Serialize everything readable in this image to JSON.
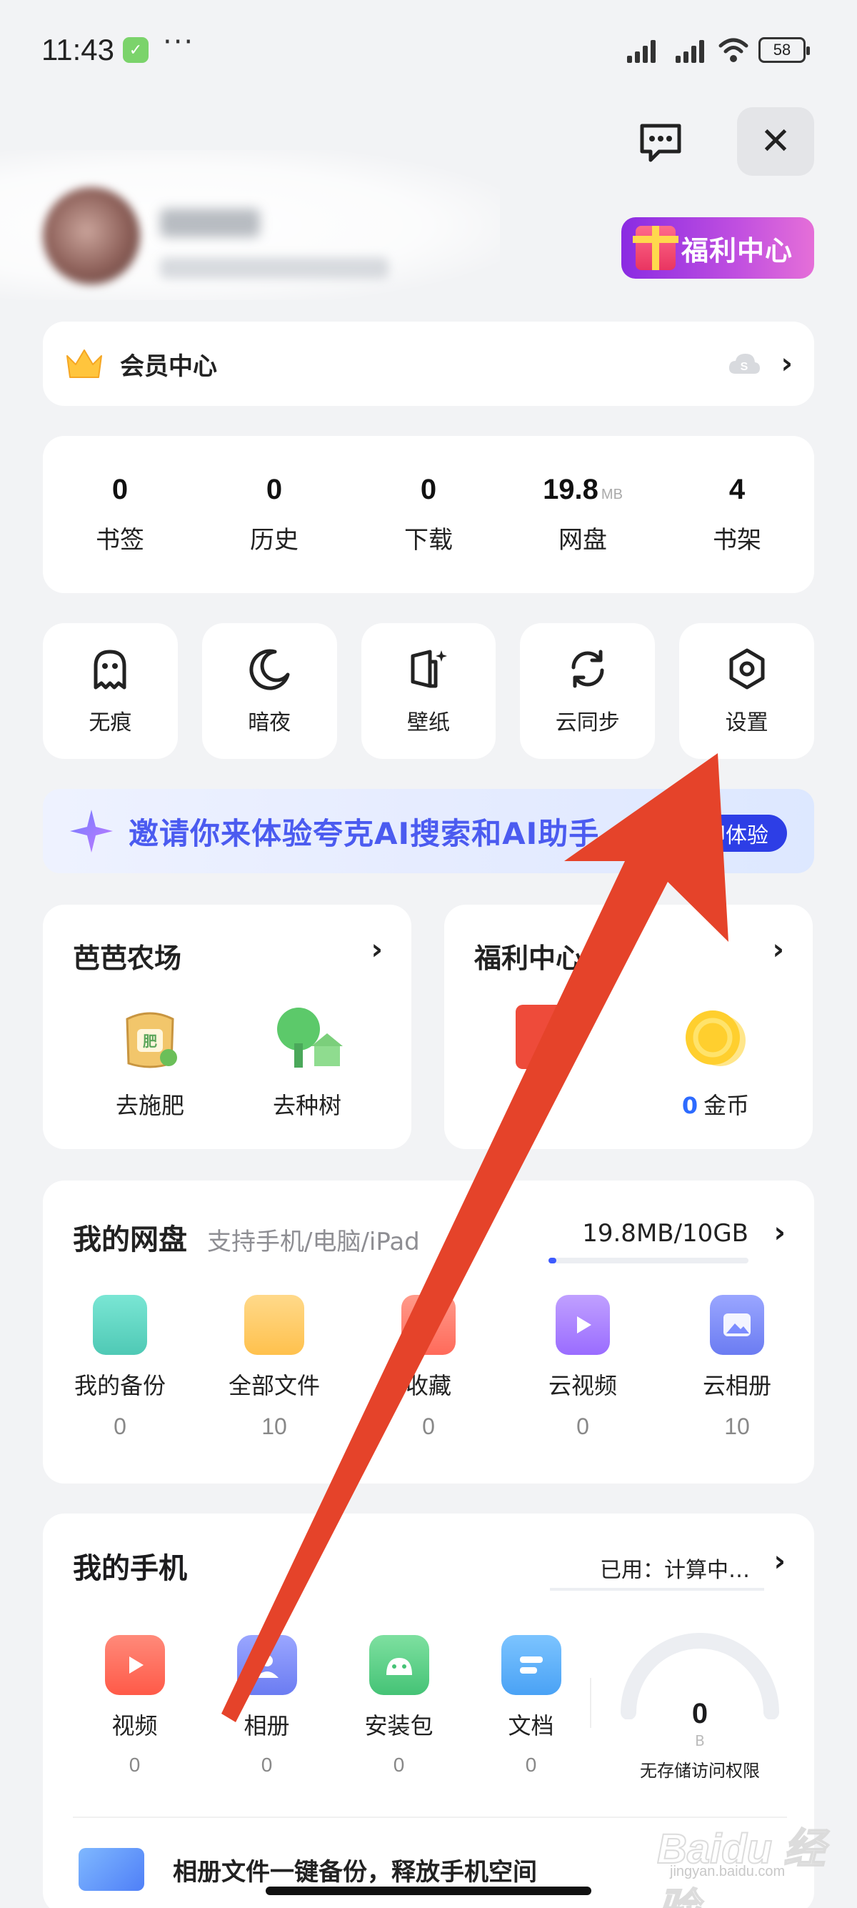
{
  "status_bar": {
    "time": "11:43",
    "battery": "58",
    "dots": "···"
  },
  "header": {
    "close_glyph": "✕",
    "welfare_label": "福利中心"
  },
  "member": {
    "label": "会员中心"
  },
  "stats": [
    {
      "value": "0",
      "unit": "",
      "label": "书签"
    },
    {
      "value": "0",
      "unit": "",
      "label": "历史"
    },
    {
      "value": "0",
      "unit": "",
      "label": "下载"
    },
    {
      "value": "19.8",
      "unit": "MB",
      "label": "网盘"
    },
    {
      "value": "4",
      "unit": "",
      "label": "书架"
    }
  ],
  "tools": [
    {
      "label": "无痕",
      "icon": "ghost-icon"
    },
    {
      "label": "暗夜",
      "icon": "moon-icon"
    },
    {
      "label": "壁纸",
      "icon": "wallpaper-icon"
    },
    {
      "label": "云同步",
      "icon": "sync-icon"
    },
    {
      "label": "设置",
      "icon": "settings-icon"
    }
  ],
  "ai_banner": {
    "text": "邀请你来体验夸克AI搜索和AI助手",
    "button": "立即体验"
  },
  "farm": {
    "title": "芭芭农场",
    "items": [
      {
        "label": "去施肥",
        "badge": "肥"
      },
      {
        "label": "去种树"
      }
    ]
  },
  "welfare": {
    "title": "福利中心",
    "coin_count": "0",
    "coin_label": "金币"
  },
  "disk": {
    "title": "我的网盘",
    "subtitle": "支持手机/电脑/iPad",
    "usage": "19.8MB/10GB",
    "usage_fraction": 0.002,
    "items": [
      {
        "label": "我的备份",
        "count": "0",
        "color": "#5fd6c4"
      },
      {
        "label": "全部文件",
        "count": "10",
        "color": "#ffc95c"
      },
      {
        "label": "收藏",
        "count": "0",
        "color": "#ff7a6b"
      },
      {
        "label": "云视频",
        "count": "0",
        "color": "#a77cff"
      },
      {
        "label": "云相册",
        "count": "10",
        "color": "#7c8cff"
      }
    ]
  },
  "phone": {
    "title": "我的手机",
    "used": "已用：计算中…",
    "items": [
      {
        "label": "视频",
        "count": "0",
        "color": "#ff6b5e"
      },
      {
        "label": "相册",
        "count": "0",
        "color": "#7b8cff"
      },
      {
        "label": "安装包",
        "count": "0",
        "color": "#5ad08a"
      },
      {
        "label": "文档",
        "count": "0",
        "color": "#5ab6ff"
      }
    ],
    "gauge_value": "0",
    "gauge_unit": "B",
    "gauge_caption": "无存储访问权限",
    "backup_text": "相册文件一键备份，释放手机空间"
  },
  "watermark": {
    "text": "Baidu 经验",
    "url": "jingyan.baidu.com"
  },
  "colors": {
    "accent": "#2d3ee6",
    "arrow": "#e5432a",
    "welfare_gradient_start": "#8a2be2"
  }
}
